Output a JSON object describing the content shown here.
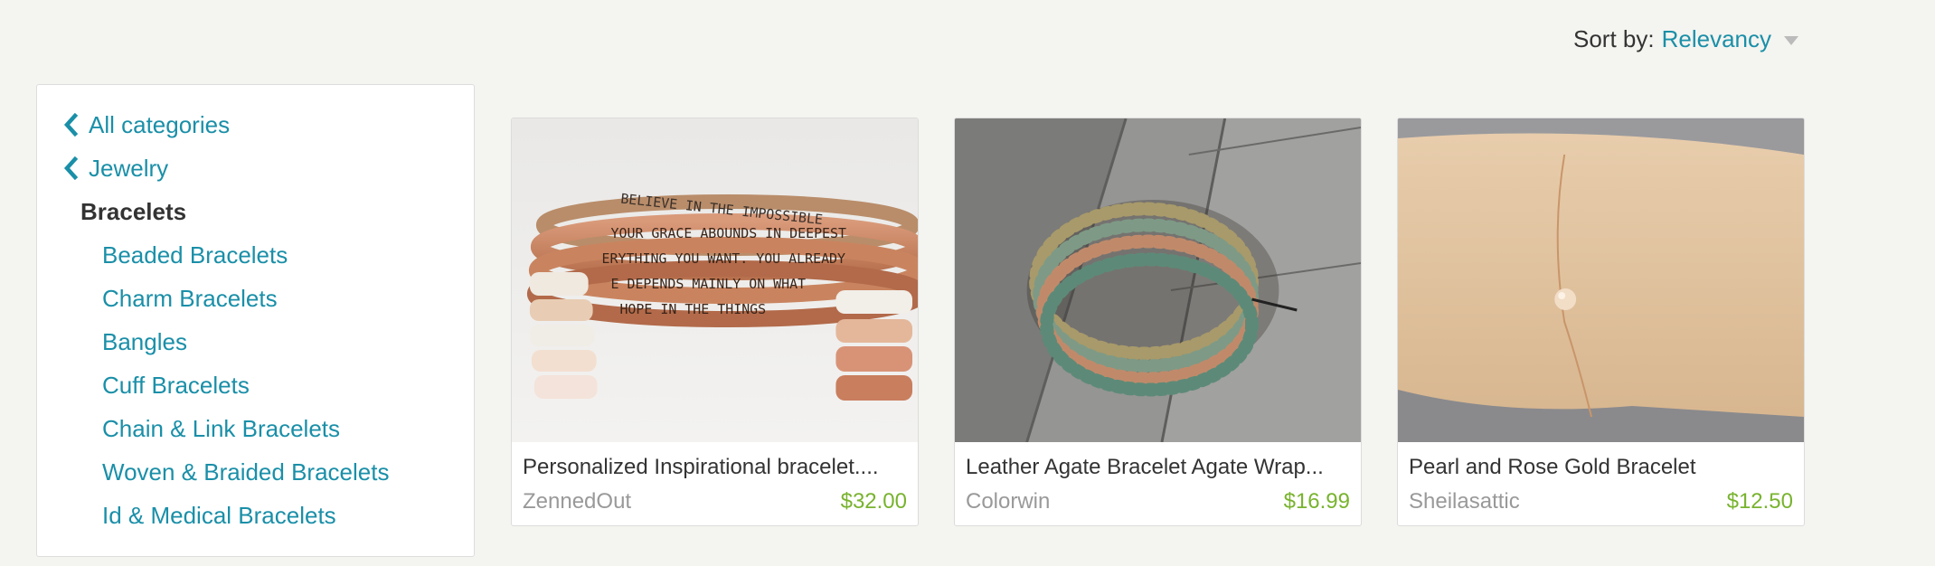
{
  "sort": {
    "label": "Sort by:",
    "value": "Relevancy"
  },
  "sidebar": {
    "back_links": [
      {
        "label": "All categories",
        "icon": "chevron-left-icon"
      },
      {
        "label": "Jewelry",
        "icon": "chevron-left-icon"
      }
    ],
    "current": "Bracelets",
    "subcategories": [
      "Beaded Bracelets",
      "Charm Bracelets",
      "Bangles",
      "Cuff Bracelets",
      "Chain & Link Bracelets",
      "Woven & Braided Bracelets",
      "Id & Medical Bracelets"
    ]
  },
  "listings": [
    {
      "title": "Personalized Inspirational bracelet....",
      "shop": "ZennedOut",
      "price": "$32.00"
    },
    {
      "title": "Leather Agate Bracelet Agate Wrap...",
      "shop": "Colorwin",
      "price": "$16.99"
    },
    {
      "title": "Pearl and Rose Gold Bracelet",
      "shop": "Sheilasattic",
      "price": "$12.50"
    }
  ],
  "colors": {
    "link": "#1a8fa8",
    "price": "#78b32e",
    "background": "#f4f4f0"
  }
}
